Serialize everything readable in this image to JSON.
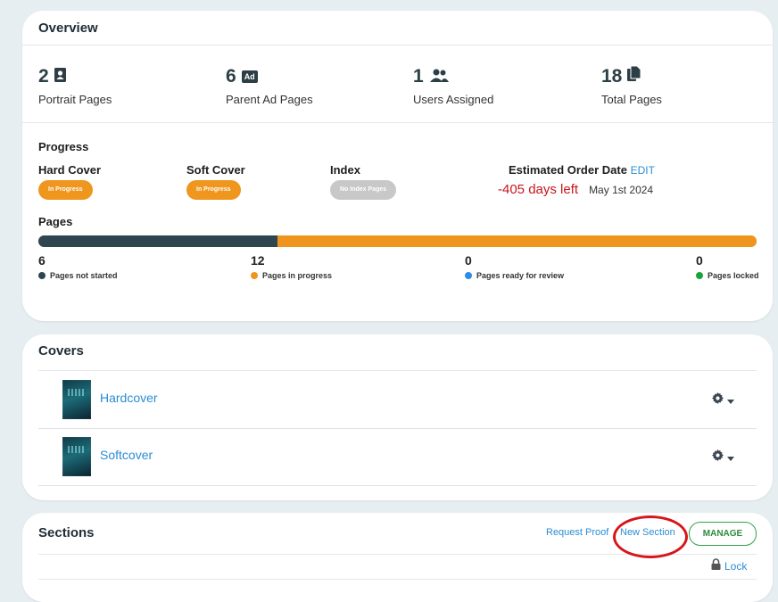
{
  "overview": {
    "title": "Overview",
    "stats": [
      {
        "value": "2",
        "label": "Portrait Pages",
        "icon": "portrait-icon"
      },
      {
        "value": "6",
        "label": "Parent Ad Pages",
        "icon": "ad-icon"
      },
      {
        "value": "1",
        "label": "Users Assigned",
        "icon": "users-icon"
      },
      {
        "value": "18",
        "label": "Total Pages",
        "icon": "pages-icon"
      }
    ],
    "ad_badge": "Ad"
  },
  "progress": {
    "title": "Progress",
    "hard_cover": {
      "label": "Hard Cover",
      "status": "In Progress"
    },
    "soft_cover": {
      "label": "Soft Cover",
      "status": "In Progress"
    },
    "index": {
      "label": "Index",
      "status": "No Index Pages"
    },
    "order_date": {
      "label": "Estimated Order Date",
      "edit": "EDIT",
      "days_left": "-405 days left",
      "date": "May 1st 2024"
    },
    "pages_title": "Pages",
    "page_stats": [
      {
        "value": "6",
        "label": "Pages not started",
        "color": "#2f4650"
      },
      {
        "value": "12",
        "label": "Pages in progress",
        "color": "#ef951d"
      },
      {
        "value": "0",
        "label": "Pages ready for review",
        "color": "#2b8de3"
      },
      {
        "value": "0",
        "label": "Pages locked",
        "color": "#1aa33a"
      }
    ]
  },
  "covers": {
    "title": "Covers",
    "items": [
      {
        "label": "Hardcover"
      },
      {
        "label": "Softcover"
      }
    ]
  },
  "sections": {
    "title": "Sections",
    "request_proof": "Request Proof",
    "new_section": "New Section",
    "manage": "MANAGE",
    "lock": "Lock"
  },
  "colors": {
    "accent_blue": "#2a8dd4",
    "orange": "#ef951d",
    "dark": "#2f4650",
    "red": "#c8161d",
    "green": "#2e8b3d"
  }
}
